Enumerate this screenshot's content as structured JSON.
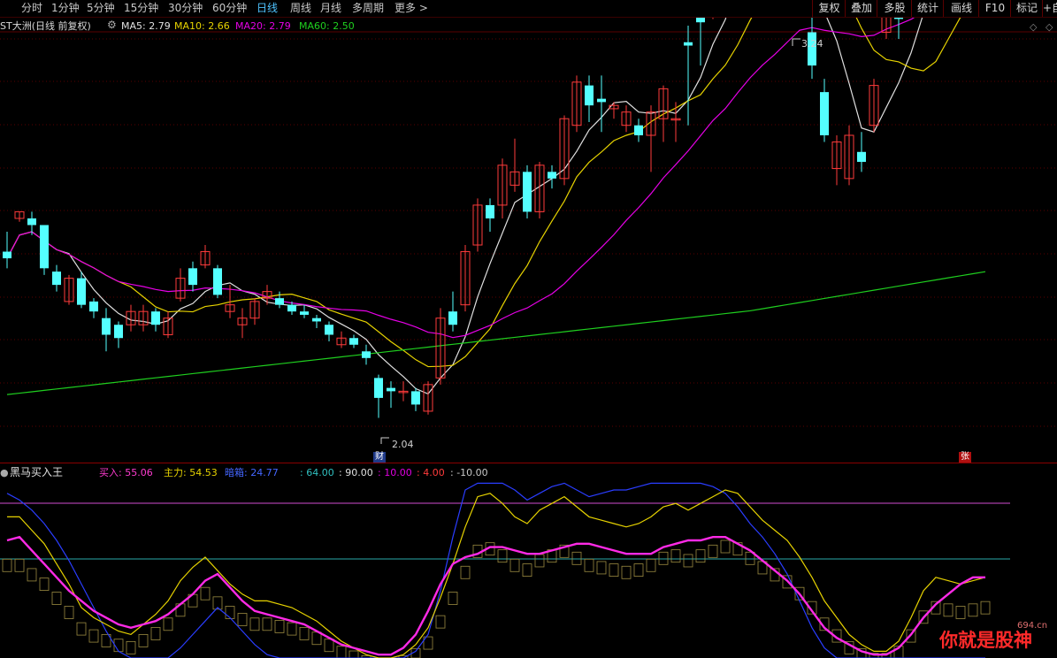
{
  "toolbar": {
    "periods": [
      "分时",
      "1分钟",
      "5分钟",
      "15分钟",
      "30分钟",
      "60分钟",
      "日线",
      "周线",
      "月线",
      "多周期",
      "更多 >"
    ],
    "active_period": "日线",
    "right_buttons": [
      "复权",
      "叠加",
      "多股",
      "统计",
      "画线",
      "F10",
      "标记",
      "+自"
    ]
  },
  "main_legend": {
    "title": "ST大洲(日线 前复权)",
    "ma5": "MA5: 2.79",
    "ma10": "MA10: 2.66",
    "ma20": "MA20: 2.79",
    "ma60": "MA60: 2.50"
  },
  "annotations": {
    "high": "3.24",
    "low": "2.04",
    "cai_badge": "财",
    "zhang_badge": "张"
  },
  "indicator_legend": {
    "title": "黑马买入王",
    "buy": "买入: 55.06",
    "main_force": "主力: 54.53",
    "dark": "暗箱: 24.77",
    "levels": [
      ": 64.00",
      ": 90.00",
      ": 10.00",
      ": 4.00",
      ": -10.00"
    ]
  },
  "watermark": {
    "text": "你就是股神",
    "site": "694.cn"
  },
  "colors": {
    "up": "#ff3b3b",
    "down": "#54ffff",
    "ma5": "#e0e0e0",
    "ma10": "#e6d200",
    "ma20": "#e600e6",
    "ma60": "#1fcf1f"
  },
  "chart_data": {
    "type": "candlestick",
    "candles": [
      [
        2.6,
        2.58,
        2.66,
        2.55
      ],
      [
        2.7,
        2.72,
        2.72,
        2.69
      ],
      [
        2.7,
        2.68,
        2.72,
        2.65
      ],
      [
        2.68,
        2.55,
        2.68,
        2.53
      ],
      [
        2.54,
        2.5,
        2.56,
        2.48
      ],
      [
        2.45,
        2.52,
        2.53,
        2.44
      ],
      [
        2.52,
        2.44,
        2.54,
        2.43
      ],
      [
        2.45,
        2.42,
        2.46,
        2.4
      ],
      [
        2.4,
        2.35,
        2.43,
        2.3
      ],
      [
        2.38,
        2.34,
        2.39,
        2.31
      ],
      [
        2.38,
        2.42,
        2.44,
        2.36
      ],
      [
        2.38,
        2.42,
        2.44,
        2.36
      ],
      [
        2.42,
        2.38,
        2.43,
        2.36
      ],
      [
        2.35,
        2.4,
        2.42,
        2.34
      ],
      [
        2.46,
        2.52,
        2.55,
        2.45
      ],
      [
        2.55,
        2.5,
        2.57,
        2.48
      ],
      [
        2.56,
        2.6,
        2.62,
        2.55
      ],
      [
        2.55,
        2.47,
        2.56,
        2.46
      ],
      [
        2.42,
        2.44,
        2.5,
        2.4
      ],
      [
        2.38,
        2.4,
        2.43,
        2.34
      ],
      [
        2.4,
        2.45,
        2.46,
        2.38
      ],
      [
        2.46,
        2.48,
        2.5,
        2.44
      ],
      [
        2.46,
        2.44,
        2.48,
        2.43
      ],
      [
        2.44,
        2.42,
        2.45,
        2.41
      ],
      [
        2.42,
        2.41,
        2.44,
        2.4
      ],
      [
        2.4,
        2.39,
        2.41,
        2.37
      ],
      [
        2.38,
        2.35,
        2.39,
        2.33
      ],
      [
        2.32,
        2.34,
        2.36,
        2.31
      ],
      [
        2.34,
        2.32,
        2.35,
        2.31
      ],
      [
        2.3,
        2.28,
        2.32,
        2.26
      ],
      [
        2.22,
        2.16,
        2.23,
        2.1
      ],
      [
        2.19,
        2.18,
        2.21,
        2.13
      ],
      [
        2.18,
        2.18,
        2.21,
        2.15
      ],
      [
        2.18,
        2.14,
        2.19,
        2.12
      ],
      [
        2.12,
        2.2,
        2.21,
        2.11
      ],
      [
        2.22,
        2.4,
        2.43,
        2.2
      ],
      [
        2.42,
        2.38,
        2.48,
        2.36
      ],
      [
        2.44,
        2.6,
        2.62,
        2.42
      ],
      [
        2.62,
        2.74,
        2.76,
        2.6
      ],
      [
        2.74,
        2.7,
        2.76,
        2.66
      ],
      [
        2.74,
        2.86,
        2.88,
        2.7
      ],
      [
        2.8,
        2.84,
        2.94,
        2.78
      ],
      [
        2.84,
        2.72,
        2.86,
        2.7
      ],
      [
        2.72,
        2.86,
        2.87,
        2.7
      ],
      [
        2.84,
        2.82,
        2.86,
        2.79
      ],
      [
        2.82,
        3.0,
        3.01,
        2.8
      ],
      [
        2.98,
        3.11,
        3.13,
        2.96
      ],
      [
        3.1,
        3.04,
        3.13,
        2.99
      ],
      [
        3.06,
        3.05,
        3.13,
        2.96
      ],
      [
        3.03,
        3.04,
        3.05,
        3.0
      ],
      [
        2.98,
        3.02,
        3.04,
        2.96
      ],
      [
        2.98,
        2.95,
        3.0,
        2.93
      ],
      [
        2.95,
        3.02,
        3.04,
        2.84
      ],
      [
        3.0,
        3.09,
        3.1,
        2.93
      ],
      [
        3.0,
        3.0,
        3.05,
        2.93
      ],
      [
        3.23,
        3.22,
        3.28,
        2.98
      ],
      [
        3.32,
        3.29,
        3.32,
        3.16
      ],
      [
        3.42,
        3.52,
        3.54,
        3.3
      ],
      [
        3.52,
        3.46,
        3.58,
        3.42
      ],
      [
        3.58,
        3.65,
        3.74,
        3.52
      ],
      [
        3.76,
        3.76,
        3.88,
        3.74
      ],
      [
        3.68,
        3.6,
        3.7,
        3.55
      ],
      [
        3.6,
        3.37,
        3.72,
        3.35
      ],
      [
        3.5,
        3.59,
        3.77,
        3.5
      ],
      [
        3.52,
        3.54,
        3.58,
        3.5
      ],
      [
        3.26,
        3.16,
        3.43,
        3.12
      ],
      [
        3.08,
        2.95,
        3.12,
        2.93
      ],
      [
        2.85,
        2.93,
        2.95,
        2.8
      ],
      [
        2.82,
        2.95,
        2.98,
        2.8
      ],
      [
        2.9,
        2.87,
        2.96,
        2.84
      ],
      [
        2.98,
        3.1,
        3.12,
        2.96
      ],
      [
        3.26,
        3.32,
        3.38,
        3.24
      ],
      [
        3.32,
        3.3,
        3.36,
        3.24
      ],
      [
        3.38,
        3.4,
        3.44,
        3.34
      ],
      [
        3.4,
        3.46,
        3.48,
        3.38
      ],
      [
        3.46,
        3.44,
        3.5,
        3.42
      ],
      [
        3.5,
        3.62,
        3.68,
        3.48
      ],
      [
        3.62,
        3.6,
        3.66,
        3.56
      ],
      [
        3.58,
        3.64,
        3.66,
        3.52
      ],
      [
        3.62,
        3.56,
        3.64,
        3.5
      ]
    ]
  }
}
